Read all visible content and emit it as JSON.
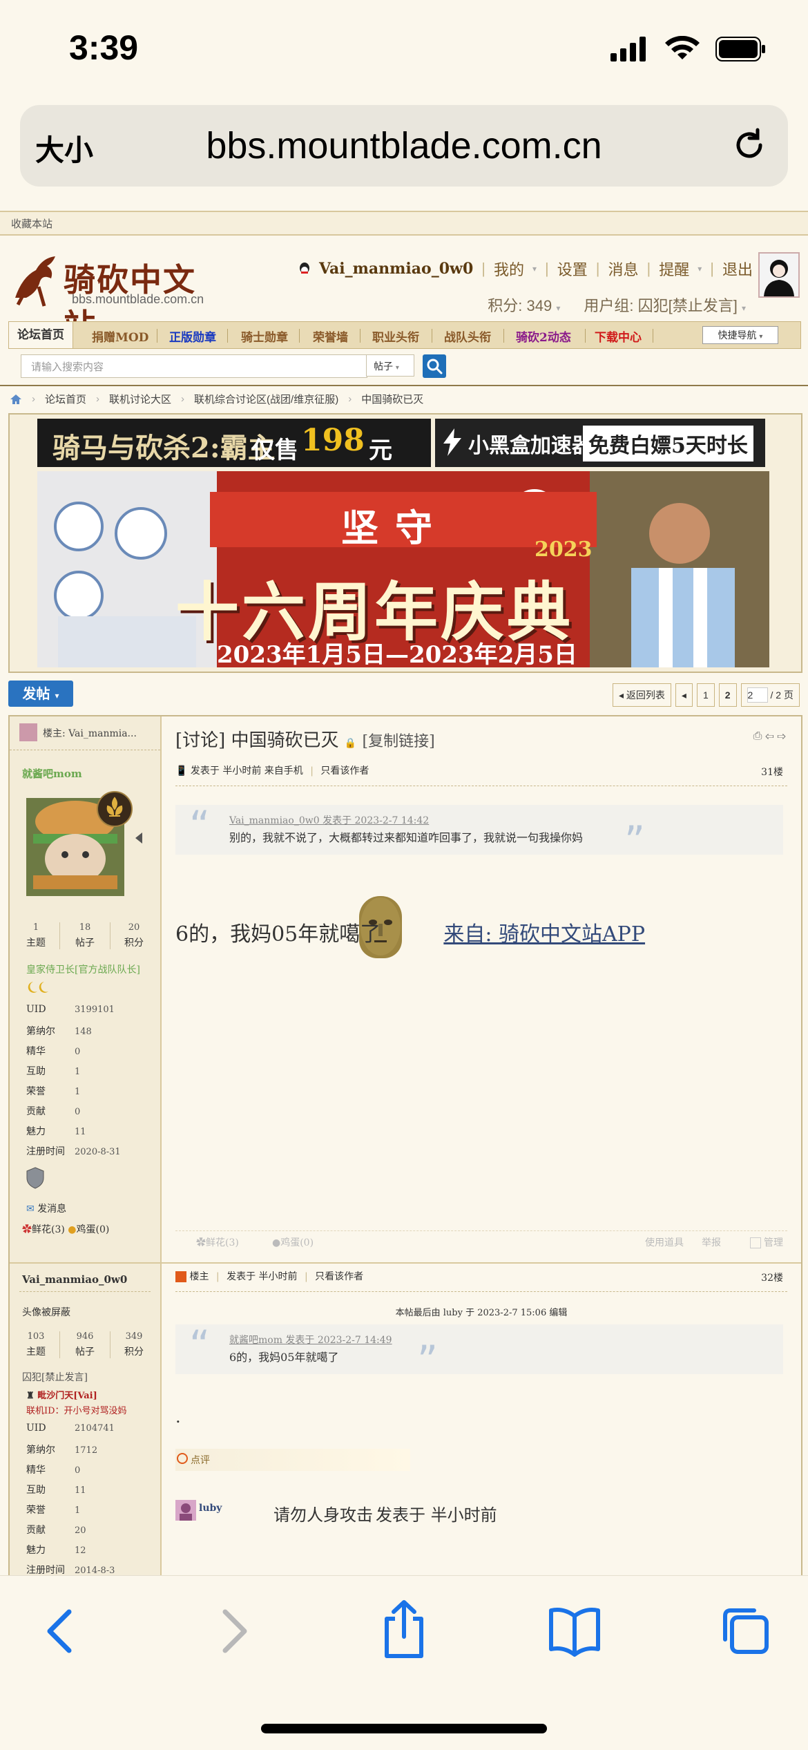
{
  "status_bar": {
    "time": "3:39"
  },
  "browser": {
    "text_size_label": "大小",
    "url": "bbs.mountblade.com.cn"
  },
  "site": {
    "top_link": "收藏本站",
    "logo_title": "骑砍中文站",
    "logo_sub": "bbs.mountblade.com.cn",
    "user": {
      "name": "Vai_manmiao_0w0",
      "links": [
        "我的",
        "设置",
        "消息",
        "提醒",
        "退出"
      ],
      "score": "积分: 349",
      "group": "用户组: 囚犯[禁止发言]"
    },
    "nav": [
      {
        "label": "论坛首页",
        "color": "#333333"
      },
      {
        "label": "捐赠MOD",
        "color": "#8a5a2a"
      },
      {
        "label": "正版勋章",
        "color": "#1a3ac0"
      },
      {
        "label": "骑士勋章",
        "color": "#8a5a2a"
      },
      {
        "label": "荣誉墙",
        "color": "#8a5a2a"
      },
      {
        "label": "职业头衔",
        "color": "#8a5a2a"
      },
      {
        "label": "战队头衔",
        "color": "#8a5a2a"
      },
      {
        "label": "骑砍2动态",
        "color": "#8a1a8a"
      },
      {
        "label": "下载中心",
        "color": "#d01a1a"
      }
    ],
    "quick_nav": "快捷导航",
    "search": {
      "placeholder": "请输入搜索内容",
      "type": "帖子"
    },
    "breadcrumb": [
      "论坛首页",
      "联机讨论大区",
      "联机综合讨论区(战团/维京征服)",
      "中国骑砍已灭"
    ],
    "ads": {
      "ad1_title": "骑马与砍杀2:霸主",
      "ad1_price_prefix": "仅售",
      "ad1_price": "198",
      "ad1_price_unit": "元",
      "ad2_title": "小黑盒加速器",
      "ad2_badge": "免费白嫖5天时长",
      "banner_top": "坚守",
      "banner_year": "2023",
      "banner_main": "十六周年庆典",
      "banner_dates": "2023年1月5日—2023年2月5日"
    }
  },
  "thread": {
    "new_post": "发帖",
    "pager": {
      "back": "返回列表",
      "pages": [
        "1",
        "2"
      ],
      "current_input": "2",
      "total": "/ 2 页"
    },
    "title": "[讨论] 中国骑砍已灭",
    "copy_link": "[复制链接]",
    "post1": {
      "lz_label": "楼主: Vai_manmia...",
      "poster": "就酱吧mom",
      "stats": [
        {
          "n": "1",
          "l": "主题"
        },
        {
          "n": "18",
          "l": "帖子"
        },
        {
          "n": "20",
          "l": "积分"
        }
      ],
      "group": "皇家侍卫长[官方战队队长]",
      "fields": [
        {
          "k": "UID",
          "v": "3199101"
        },
        {
          "k": "第纳尔",
          "v": "148"
        },
        {
          "k": "精华",
          "v": "0"
        },
        {
          "k": "互助",
          "v": "1"
        },
        {
          "k": "荣誉",
          "v": "1"
        },
        {
          "k": "贡献",
          "v": "0"
        },
        {
          "k": "魅力",
          "v": "11"
        },
        {
          "k": "注册时间",
          "v": "2020-8-31"
        }
      ],
      "send_msg": "发消息",
      "flowers": "鲜花(3)",
      "eggs": "鸡蛋(0)",
      "meta": "发表于 半小时前 来自手机",
      "only_author": "只看该作者",
      "floor": "31楼",
      "quote_head": "Vai_manmiao_0w0 发表于 2023-2-7 14:42",
      "quote_body": "别的，我就不说了，大概都转过来都知道咋回事了，我就说一句我操你妈",
      "body": "6的，我妈05年就噶了",
      "app_link": "来自: 骑砍中文站APP",
      "foot_left": [
        "鲜花(3)",
        "鸡蛋(0)"
      ],
      "foot_right": [
        "使用道具",
        "举报",
        "管理"
      ]
    },
    "post2": {
      "poster": "Vai_manmiao_0w0",
      "avatar_blocked": "头像被屏蔽",
      "stats": [
        {
          "n": "103",
          "l": "主题"
        },
        {
          "n": "946",
          "l": "帖子"
        },
        {
          "n": "349",
          "l": "积分"
        }
      ],
      "group": "囚犯[禁止发言]",
      "team": "毗沙门天[Vai]",
      "online_id": "联机ID：开小号对骂没妈",
      "fields": [
        {
          "k": "UID",
          "v": "2104741"
        },
        {
          "k": "第纳尔",
          "v": "1712"
        },
        {
          "k": "精华",
          "v": "0"
        },
        {
          "k": "互助",
          "v": "11"
        },
        {
          "k": "荣誉",
          "v": "1"
        },
        {
          "k": "贡献",
          "v": "20"
        },
        {
          "k": "魅力",
          "v": "12"
        },
        {
          "k": "注册时间",
          "v": "2014-8-3"
        }
      ],
      "lz": "楼主",
      "meta": "发表于 半小时前",
      "only_author": "只看该作者",
      "floor": "32楼",
      "edit_note": "本帖最后由 luby 于 2023-2-7 15:06 编辑",
      "quote_head": "就酱吧mom 发表于 2023-2-7 14:49",
      "quote_body": "6的，我妈05年就噶了",
      "body": ".",
      "comment": "点评",
      "reviewer": "luby",
      "review_text": "请勿人身攻击",
      "review_time": "发表于 半小时前"
    }
  }
}
